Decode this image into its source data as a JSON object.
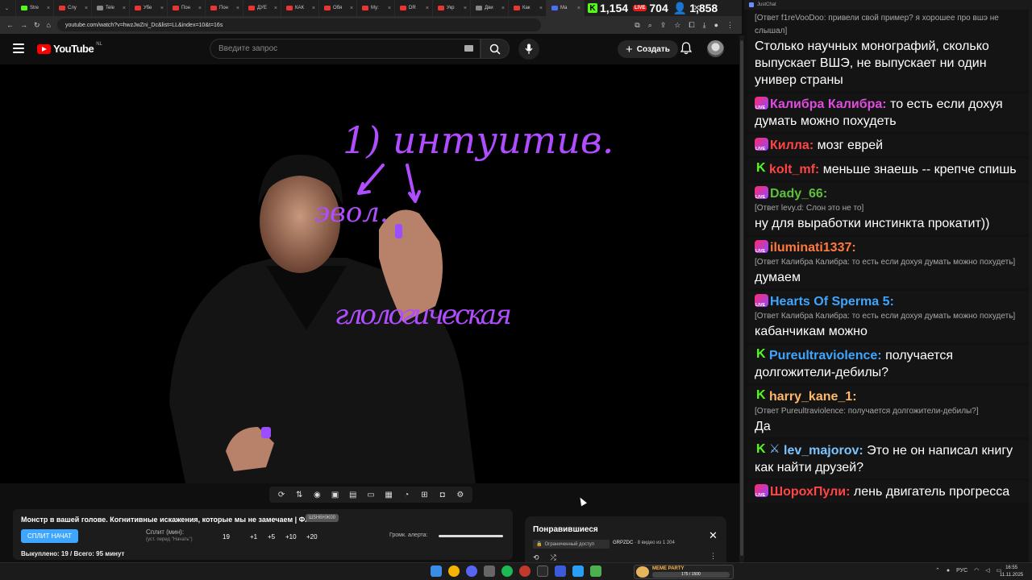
{
  "browser": {
    "tabs": [
      {
        "label": "Stre",
        "color": "#53fc18"
      },
      {
        "label": "Слу",
        "color": "#e33"
      },
      {
        "label": "Tele",
        "color": "#888"
      },
      {
        "label": "Убе",
        "color": "#e33"
      },
      {
        "label": "Пон",
        "color": "#e33"
      },
      {
        "label": "Пон",
        "color": "#e33"
      },
      {
        "label": "ДУЕ",
        "color": "#e33"
      },
      {
        "label": "КАК",
        "color": "#e33"
      },
      {
        "label": "Обя",
        "color": "#e33"
      },
      {
        "label": "Му:",
        "color": "#e33"
      },
      {
        "label": "DR",
        "color": "#e33"
      },
      {
        "label": "Укр",
        "color": "#e33"
      },
      {
        "label": "Дви",
        "color": "#888"
      },
      {
        "label": "Как",
        "color": "#e33"
      },
      {
        "label": "Ма",
        "color": "#4c6ef5"
      }
    ],
    "url": "youtube.com/watch?v=hwzJwZni_Dc&list=LL&index=10&t=16s"
  },
  "stream_stats": {
    "kick_viewers": "1,154",
    "live_viewers": "704",
    "total_viewers": "1,858"
  },
  "youtube": {
    "country": "NL",
    "logo_text": "YouTube",
    "search_placeholder": "Введите запрос",
    "create_label": "Создать"
  },
  "video_handwriting": {
    "line1": "1) интуитив.",
    "line2": "эвол.",
    "line3": "глологическая"
  },
  "split": {
    "video_title": "Монстр в вашей голове. Когнитивные искажения, которые мы не замечаем | ФАЙБ",
    "title_tag": "Ш5Н6НЖ00",
    "button": "СПЛИТ НАЧАТ",
    "label": "Сплит (мин):",
    "hint": "(уст. перед \"Начать\")",
    "value": "19",
    "increments": [
      "+1",
      "+5",
      "+10",
      "+20"
    ],
    "alert_label": "Громк. алерта:",
    "alert_volume": 1.0,
    "stats": "Выкуплено: 19 / Всего: 95 минут"
  },
  "playlist": {
    "title": "Понравившиеся",
    "access": "Ограниченный доступ",
    "channel": "GRPZDC",
    "progress": "8 видео из 1 204"
  },
  "chat": {
    "window_title": "JustChat",
    "messages": [
      {
        "reply": "[Ответ f1reVooDoo: привели свой пример? я хорошее про вшэ не слышал]",
        "text": "Столько научных монографий, сколько выпускает ВШЭ, не выпускает ни один универ страны"
      },
      {
        "badge": "live",
        "user": "Калибра Калибра:",
        "color": "#e24be0",
        "text": "то есть если дохуя думать можно похудеть"
      },
      {
        "badge": "live",
        "user": "Килла:",
        "color": "#ff4545",
        "text": "мозг еврей"
      },
      {
        "badge": "kick",
        "user": "kolt_mf:",
        "color": "#ff4545",
        "text": "меньше знаешь -- крепче спишь"
      },
      {
        "badge": "live",
        "user": "Dady_66:",
        "color": "#5fbf3a",
        "reply": "[Ответ levy.d: Слон это не то]",
        "text": "ну для выработки инстинкта прокатит))"
      },
      {
        "badge": "live",
        "user": "iluminati1337:",
        "color": "#ff7a3d",
        "reply": "[Ответ Калибра Калибра: то есть если дохуя думать можно похудеть]",
        "text": "думаем"
      },
      {
        "badge": "live",
        "user": "Hearts Of Sperma 5:",
        "color": "#3ea6ff",
        "reply": "[Ответ Калибра Калибра: то есть если дохуя думать можно похудеть]",
        "text": "кабанчикам можно"
      },
      {
        "badge": "kick",
        "user": "Pureultraviolence:",
        "color": "#3ea6ff",
        "text": "получается долгожители-дебилы?"
      },
      {
        "badge": "kick",
        "user": "harry_kane_1:",
        "color": "#ffb86c",
        "reply": "[Ответ Pureultraviolence: получается долгожители-дебилы?]",
        "text": "Да"
      },
      {
        "badge": "kick",
        "badge2": "sword",
        "user": "lev_majorov:",
        "color": "#7cc4ff",
        "text": "Это не он написал книгу как найти друзей?"
      },
      {
        "badge": "live",
        "user": "ШорохПули:",
        "color": "#ff4545",
        "text": "лень двигатель прогресса"
      }
    ]
  },
  "taskbar": {
    "widget_name": "MEME PARTY",
    "widget_progress": "175 / 1500",
    "lang": "РУС",
    "time": "16:55",
    "date": "11.11.2025"
  }
}
